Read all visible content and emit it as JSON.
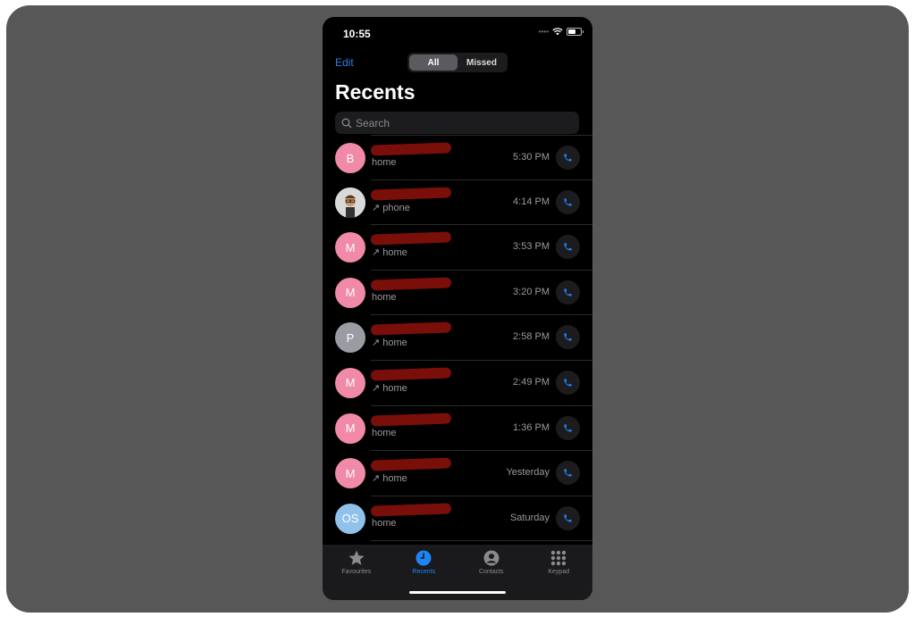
{
  "status_bar": {
    "time": "10:55"
  },
  "nav": {
    "edit_label": "Edit",
    "segments": [
      {
        "label": "All",
        "active": true
      },
      {
        "label": "Missed",
        "active": false
      }
    ]
  },
  "page_title": "Recents",
  "search": {
    "placeholder": "Search"
  },
  "recents": [
    {
      "initials": "B",
      "avatar_color": "#f08aa6",
      "name": "[redacted]",
      "label": "home",
      "outgoing": false,
      "time": "5:30 PM"
    },
    {
      "initials": "",
      "avatar_color": "#dcdcdc",
      "name": "[redacted]",
      "label": "phone",
      "outgoing": true,
      "time": "4:14 PM",
      "photo": true
    },
    {
      "initials": "M",
      "avatar_color": "#f08aa6",
      "name": "[redacted]",
      "label": "home",
      "outgoing": true,
      "time": "3:53 PM"
    },
    {
      "initials": "M",
      "avatar_color": "#f08aa6",
      "name": "[redacted]",
      "label": "home",
      "outgoing": false,
      "time": "3:20 PM"
    },
    {
      "initials": "P",
      "avatar_color": "#9a9ca4",
      "name": "[redacted]",
      "label": "home",
      "outgoing": true,
      "time": "2:58 PM"
    },
    {
      "initials": "M",
      "avatar_color": "#f08aa6",
      "name": "[redacted]",
      "label": "home",
      "outgoing": true,
      "time": "2:49 PM"
    },
    {
      "initials": "M",
      "avatar_color": "#f08aa6",
      "name": "[redacted]",
      "label": "home",
      "outgoing": false,
      "time": "1:36 PM"
    },
    {
      "initials": "M",
      "avatar_color": "#f08aa6",
      "name": "[redacted]",
      "label": "home",
      "outgoing": true,
      "time": "Yesterday"
    },
    {
      "initials": "OS",
      "avatar_color": "#8fc1ea",
      "name": "[redacted]",
      "label": "home",
      "outgoing": false,
      "time": "Saturday"
    }
  ],
  "tabbar": [
    {
      "label": "Favourites",
      "icon": "star-icon",
      "active": false
    },
    {
      "label": "Recents",
      "icon": "clock-icon",
      "active": true
    },
    {
      "label": "Contacts",
      "icon": "person-icon",
      "active": false
    },
    {
      "label": "Keypad",
      "icon": "keypad-icon",
      "active": false
    }
  ],
  "colors": {
    "accent": "#1e84f5",
    "redaction": "#7a0f0a"
  }
}
